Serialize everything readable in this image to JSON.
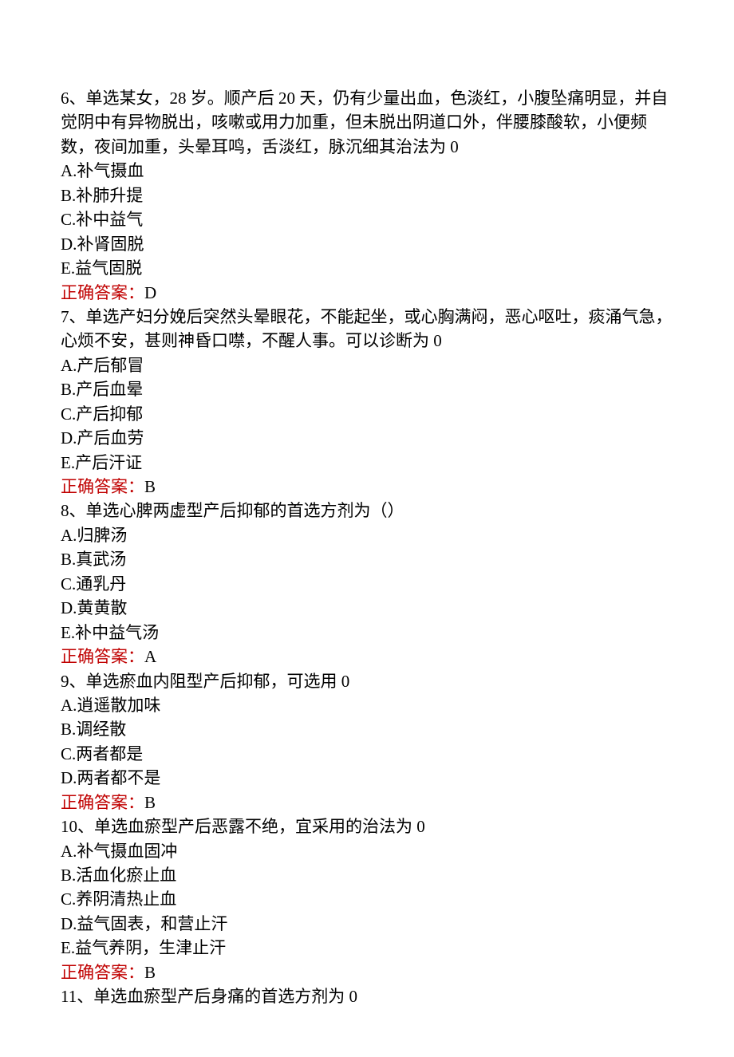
{
  "questions": [
    {
      "stem": "6、单选某女，28 岁。顺产后 20 天，仍有少量出血，色淡红，小腹坠痛明显，并自觉阴中有异物脱出，咳嗽或用力加重，但未脱出阴道口外，伴腰膝酸软，小便频数，夜间加重，头晕耳鸣，舌淡红，脉沉细其治法为 0",
      "options": [
        "A.补气摄血",
        "B.补肺升提",
        "C.补中益气",
        "D.补肾固脱",
        "E.益气固脱"
      ],
      "answerLabel": "正确答案：",
      "answerValue": "D"
    },
    {
      "stem": "7、单选产妇分娩后突然头晕眼花，不能起坐，或心胸满闷，恶心呕吐，痰涌气急，心烦不安，甚则神昏口噤，不醒人事。可以诊断为 0",
      "options": [
        "A.产后郁冒",
        "B.产后血晕",
        "C.产后抑郁",
        "D.产后血劳",
        "E.产后汗证"
      ],
      "answerLabel": "正确答案：",
      "answerValue": "B"
    },
    {
      "stem": "8、单选心脾两虚型产后抑郁的首选方剂为（）",
      "options": [
        "A.归脾汤",
        "B.真武汤",
        "C.通乳丹",
        "D.黄黄散",
        "E.补中益气汤"
      ],
      "answerLabel": "正确答案：",
      "answerValue": "A"
    },
    {
      "stem": "9、单选瘀血内阻型产后抑郁，可选用 0",
      "options": [
        "A.逍遥散加味",
        "B.调经散",
        "C.两者都是",
        "D.两者都不是"
      ],
      "answerLabel": "正确答案：",
      "answerValue": "B"
    },
    {
      "stem": "10、单选血瘀型产后恶露不绝，宜采用的治法为 0",
      "options": [
        "A.补气摄血固冲",
        "B.活血化瘀止血",
        "C.养阴清热止血",
        "D.益气固表，和营止汗",
        "E.益气养阴，生津止汗"
      ],
      "answerLabel": "正确答案：",
      "answerValue": "B"
    },
    {
      "stem": "11、单选血瘀型产后身痛的首选方剂为 0",
      "options": [],
      "answerLabel": "",
      "answerValue": ""
    }
  ]
}
